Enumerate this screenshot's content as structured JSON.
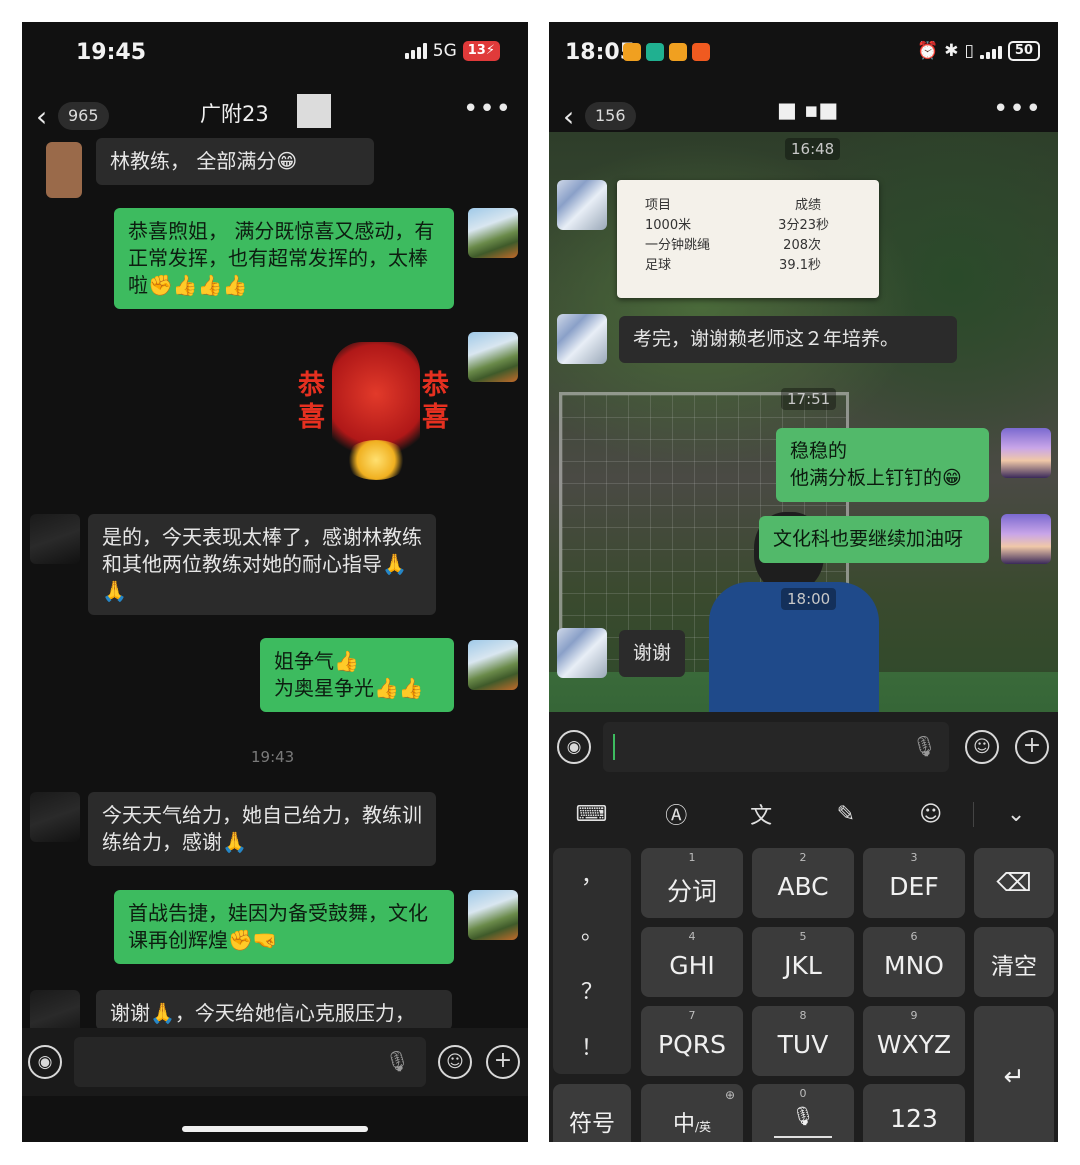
{
  "left": {
    "status": {
      "time": "19:45",
      "network": "5G",
      "battery": "13"
    },
    "nav": {
      "back_icon": "chevron-left-icon",
      "unread_count": "965",
      "title": "广附23",
      "more_icon": "more-icon"
    },
    "messages": [
      {
        "side": "in",
        "text": "林教练，        全部满分😁"
      },
      {
        "side": "out",
        "text": "恭喜煦姐，       满分既惊喜又感动，有正常发挥，也有超常发挥的，太棒啦✊👍👍👍"
      },
      {
        "side": "out",
        "type": "sticker",
        "text_left": "恭喜",
        "text_right": "恭喜"
      },
      {
        "side": "in",
        "text": "是的，今天表现太棒了，感谢林教练和其他两位教练对她的耐心指导🙏🙏"
      },
      {
        "side": "out",
        "text": "   姐争气👍\n为奥星争光👍👍"
      },
      {
        "type": "timestamp",
        "text": "19:43"
      },
      {
        "side": "in",
        "text": "今天天气给力，她自己给力，教练训练给力，感谢🙏"
      },
      {
        "side": "out",
        "text": "首战告捷，娃因为备受鼓舞，文化课再创辉煌✊🤜"
      },
      {
        "side": "in",
        "text": "谢谢🙏，今天给她信心克服压力，"
      }
    ]
  },
  "right": {
    "status": {
      "time": "18:05",
      "battery": "50"
    },
    "nav": {
      "back_icon": "chevron-left-icon",
      "unread_count": "156",
      "title": "■ ▪■",
      "more_icon": "more-icon"
    },
    "timestamps": [
      "16:48",
      "17:51",
      "18:00"
    ],
    "score_card": {
      "header_item": "项目",
      "header_score": "成绩",
      "rows": [
        {
          "item": "1000米",
          "score": "3分23秒"
        },
        {
          "item": "一分钟跳绳",
          "score": "208次"
        },
        {
          "item": "足球",
          "score": "39.1秒"
        }
      ]
    },
    "messages": [
      {
        "side": "in",
        "text": "  考完，谢谢赖老师这２年培养。"
      },
      {
        "side": "out",
        "text": "稳稳的\n他满分板上钉钉的😁"
      },
      {
        "side": "out",
        "text": "文化科也要继续加油呀"
      },
      {
        "side": "in",
        "text": "谢谢"
      }
    ],
    "keyboard": {
      "punct": [
        "，",
        "。",
        "？",
        "！"
      ],
      "keys": [
        {
          "num": "1",
          "label": "分词"
        },
        {
          "num": "2",
          "label": "ABC"
        },
        {
          "num": "3",
          "label": "DEF"
        },
        {
          "num": "4",
          "label": "GHI"
        },
        {
          "num": "5",
          "label": "JKL"
        },
        {
          "num": "6",
          "label": "MNO"
        },
        {
          "num": "7",
          "label": "PQRS"
        },
        {
          "num": "8",
          "label": "TUV"
        },
        {
          "num": "9",
          "label": "WXYZ"
        }
      ],
      "backspace_icon": "backspace-icon",
      "clear": "清空",
      "symbols": "符号",
      "lang": "中",
      "lang_sub": "/英",
      "space_num": "0",
      "numbers": "123",
      "enter_icon": "enter-icon"
    }
  },
  "colors": {
    "bubble_out": "#3dbb5f",
    "bubble_in": "#2b2b2b",
    "background": "#111111"
  }
}
